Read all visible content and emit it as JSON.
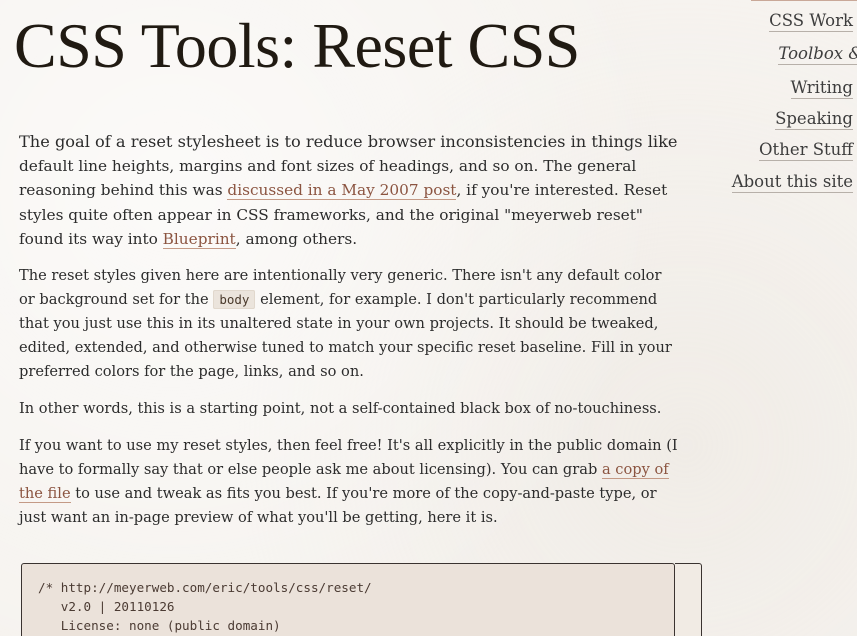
{
  "page": {
    "title": "CSS Tools: Reset CSS"
  },
  "nav": {
    "items": [
      {
        "label": "CSS Work"
      },
      {
        "label": "Toolbox &"
      },
      {
        "label": "Writing"
      },
      {
        "label": "Speaking"
      },
      {
        "label": "Other Stuff"
      },
      {
        "label": "About this site"
      }
    ]
  },
  "content": {
    "p1": {
      "lede_start": "The goal of a reset stylesheet is to reduce browser inconsistencies in things like",
      "text_a": "default line heights, margins and font sizes of headings, and so on. The general reasoning behind this was ",
      "link1": "discussed in a May 2007 post",
      "text_b": ", if you're interested. Reset styles quite often appear in CSS frameworks, and the original \"meyerweb reset\" found its way into ",
      "link2": "Blueprint",
      "text_c": ", among others."
    },
    "p2": {
      "text_a": "The reset styles given here are intentionally very generic. There isn't any default color or background set for the ",
      "code": "body",
      "text_b": " element, for example. I don't particularly recommend that you just use this in its unaltered state in your own projects. It should be tweaked, edited, extended, and otherwise tuned to match your specific reset baseline. Fill in your preferred colors for the page, links, and so on."
    },
    "p3": {
      "text": "In other words, this is a starting point, not a self-contained black box of no-touchiness."
    },
    "p4": {
      "text_a": "If you want to use my reset styles, then feel free! It's all explicitly in the public domain (I have to formally say that or else people ask me about licensing). You can grab ",
      "link": "a copy of the file",
      "text_b": " to use and tweak as fits you best. If you're more of the copy-and-paste type, or just want an in-page preview of what you'll be getting, here it is."
    }
  },
  "code_block": {
    "lines": [
      "/* http://meyerweb.com/eric/tools/css/reset/",
      "   v2.0 | 20110126",
      "   License: none (public domain)",
      "*/"
    ]
  },
  "colors": {
    "background": "#f6f3ef",
    "link": "#8b5440",
    "title": "#201a12"
  }
}
